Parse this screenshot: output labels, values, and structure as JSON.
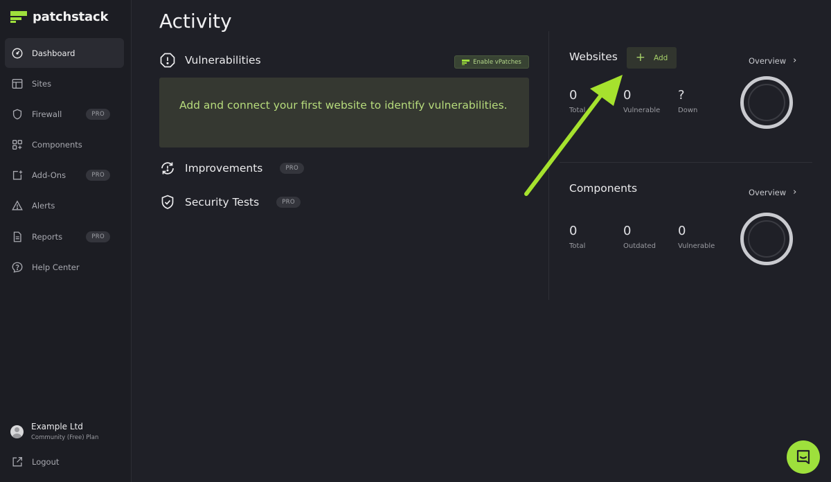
{
  "brand": {
    "name": "patchstack",
    "accent": "#9ee03c"
  },
  "sidebar": {
    "items": [
      {
        "label": "Dashboard",
        "icon": "gauge-icon",
        "active": true,
        "badge": ""
      },
      {
        "label": "Sites",
        "icon": "layout-icon",
        "active": false,
        "badge": ""
      },
      {
        "label": "Firewall",
        "icon": "shield-icon",
        "active": false,
        "badge": "PRO"
      },
      {
        "label": "Components",
        "icon": "grid-plus-icon",
        "active": false,
        "badge": ""
      },
      {
        "label": "Add-Ons",
        "icon": "addon-icon",
        "active": false,
        "badge": "PRO"
      },
      {
        "label": "Alerts",
        "icon": "warning-icon",
        "active": false,
        "badge": ""
      },
      {
        "label": "Reports",
        "icon": "document-icon",
        "active": false,
        "badge": "PRO"
      },
      {
        "label": "Help Center",
        "icon": "help-icon",
        "active": false,
        "badge": ""
      }
    ],
    "account": {
      "name": "Example Ltd",
      "plan": "Community (Free) Plan"
    },
    "logout_label": "Logout"
  },
  "main": {
    "title": "Activity",
    "vulnerabilities": {
      "label": "Vulnerabilities",
      "vpatch_label": "Enable vPatches",
      "empty_message": "Add and connect your first website to identify vulnerabilities."
    },
    "improvements": {
      "label": "Improvements",
      "badge": "PRO"
    },
    "security_tests": {
      "label": "Security Tests",
      "badge": "PRO"
    }
  },
  "websites": {
    "title": "Websites",
    "add_label": "Add",
    "overview_label": "Overview",
    "stats": [
      {
        "value": "0",
        "label": "Total"
      },
      {
        "value": "0",
        "label": "Vulnerable"
      },
      {
        "value": "?",
        "label": "Down"
      }
    ]
  },
  "components": {
    "title": "Components",
    "overview_label": "Overview",
    "stats": [
      {
        "value": "0",
        "label": "Total"
      },
      {
        "value": "0",
        "label": "Outdated"
      },
      {
        "value": "0",
        "label": "Vulnerable"
      }
    ]
  },
  "colors": {
    "background": "#1f2027",
    "sidebar": "#1c1d23",
    "annotation_arrow": "#a6e22e",
    "badge": "#34353c"
  }
}
